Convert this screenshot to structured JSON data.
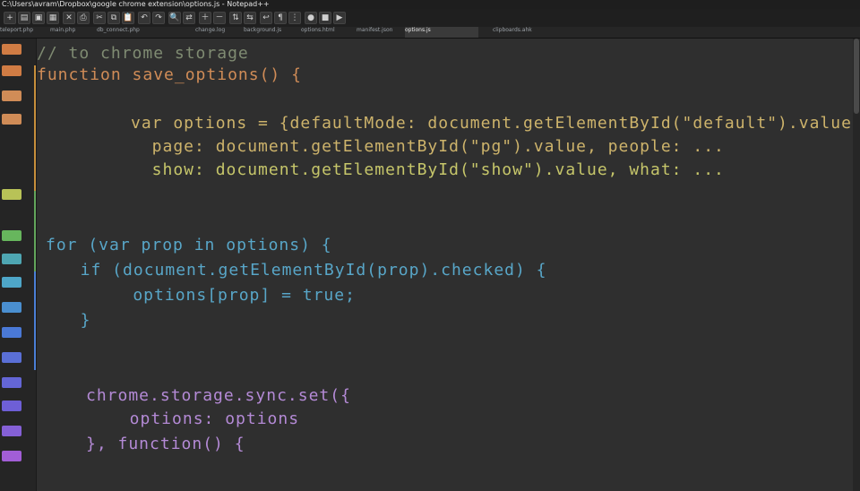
{
  "window": {
    "title": "C:\\Users\\avram\\Dropbox\\google chrome extension\\options.js - Notepad++"
  },
  "toolbar": {
    "buttons": [
      "new",
      "open",
      "save",
      "save-all",
      "close",
      "print",
      "cut",
      "copy",
      "paste",
      "undo",
      "redo",
      "find",
      "replace",
      "zoom-in",
      "zoom-out",
      "sync-v",
      "sync-h",
      "wrap",
      "all-chars",
      "indent-guide",
      "macro-record",
      "macro-stop",
      "macro-play"
    ]
  },
  "tabs": [
    {
      "label": "teleport.php"
    },
    {
      "label": "main.php"
    },
    {
      "label": "db_connect.php"
    },
    {
      "label": "change.log"
    },
    {
      "label": "background.js"
    },
    {
      "label": "options.html"
    },
    {
      "label": "manifest.json"
    },
    {
      "label": "options.js"
    },
    {
      "label": "clipboards.ahk"
    }
  ],
  "code": {
    "l1": "// to chrome storage",
    "l2": "function save_options() {",
    "l3": "var options = {defaultMode: document.getElementById(\"default\").value,",
    "l4": "  page: document.getElementById(\"pg\").value, people: ...",
    "l5": "  show: document.getElementById(\"show\").value, what: ...",
    "l6": "for (var prop in options) {",
    "l7": "  if (document.getElementById(prop).checked) {",
    "l8": "    options[prop] = true;",
    "l9": "  }",
    "l10": "chrome.storage.sync.set({",
    "l11": "  options: options",
    "l12": "}, function() {",
    "l13": ""
  }
}
